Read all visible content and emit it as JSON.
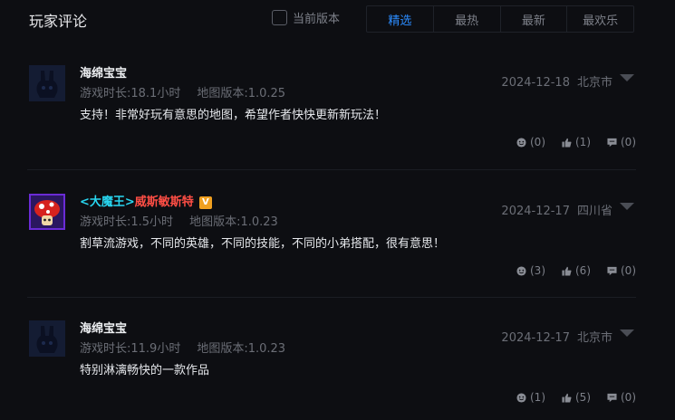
{
  "header": {
    "title": "玩家评论",
    "version_filter_label": "当前版本",
    "tabs": [
      "精选",
      "最热",
      "最新",
      "最欢乐"
    ]
  },
  "comments": [
    {
      "user_name": "海绵宝宝",
      "play_time": "游戏时长:18.1小时",
      "map_version": "地图版本:1.0.25",
      "date": "2024-12-18",
      "location": "北京市",
      "text": "支持！非常好玩有意思的地图，希望作者快快更新新玩法！",
      "counts": {
        "happy": "(0)",
        "like": "(1)",
        "reply": "(0)"
      }
    },
    {
      "user_name_prefix": "<大魔王>",
      "user_name": "威斯敏斯特",
      "vip_badge": "V",
      "play_time": "游戏时长:1.5小时",
      "map_version": "地图版本:1.0.23",
      "date": "2024-12-17",
      "location": "四川省",
      "text": "割草流游戏，不同的英雄，不同的技能，不同的小弟搭配，很有意思！",
      "counts": {
        "happy": "(3)",
        "like": "(6)",
        "reply": "(0)"
      }
    },
    {
      "user_name": "海绵宝宝",
      "play_time": "游戏时长:11.9小时",
      "map_version": "地图版本:1.0.23",
      "date": "2024-12-17",
      "location": "北京市",
      "text": "特别淋漓畅快的一款作品",
      "counts": {
        "happy": "(1)",
        "like": "(5)",
        "reply": "(0)"
      }
    }
  ],
  "icons": {
    "avatar_default": "rabbit-avatar-icon",
    "avatar_custom": "mushroom-avatar-icon",
    "happy": "smile-face-icon",
    "like": "thumbs-up-icon",
    "reply": "comment-bubble-icon",
    "more": "chevron-down-icon"
  },
  "colors": {
    "background": "#0d0e12",
    "active_tab": "#2b8cff",
    "guild_tag": "#28d6f0",
    "highlight_name": "#ff4e45",
    "vip_badge": "#f0a020"
  }
}
